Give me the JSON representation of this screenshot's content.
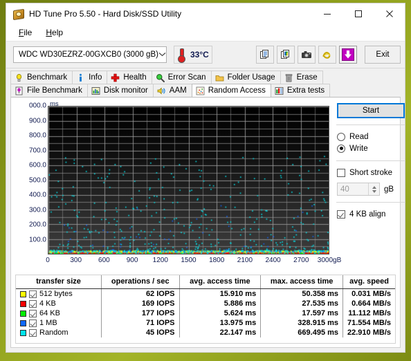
{
  "window": {
    "title": "HD Tune Pro 5.50 - Hard Disk/SSD Utility",
    "icon": "hard-disk-icon",
    "minimize": "—",
    "maximize": "☐",
    "close": "✕"
  },
  "menu": {
    "items": [
      {
        "label": "File",
        "accel": "F"
      },
      {
        "label": "Help",
        "accel": "H"
      }
    ]
  },
  "toolbar": {
    "drive": "WDC WD30EZRZ-00GXCB0 (3000 gB)",
    "drive_chevron": "⌄",
    "temperature": "33°C",
    "thermometer_icon": "thermometer-icon",
    "buttons": [
      {
        "name": "copy-text-button",
        "icon": "copy-text-icon"
      },
      {
        "name": "copy-image-button",
        "icon": "copy-image-icon"
      },
      {
        "name": "screenshot-button",
        "icon": "camera-icon"
      },
      {
        "name": "sound-button",
        "icon": "sound-wave-icon"
      },
      {
        "name": "save-button",
        "icon": "download-arrow-icon"
      }
    ],
    "exit_label": "Exit"
  },
  "tabs": {
    "row1": [
      {
        "label": "Benchmark",
        "icon": "lightbulb-icon",
        "active": false
      },
      {
        "label": "Info",
        "icon": "info-icon",
        "active": false
      },
      {
        "label": "Health",
        "icon": "red-cross-icon",
        "active": false
      },
      {
        "label": "Error Scan",
        "icon": "magnifier-icon",
        "active": false
      },
      {
        "label": "Folder Usage",
        "icon": "folder-icon",
        "active": false
      },
      {
        "label": "Erase",
        "icon": "trash-icon",
        "active": false
      }
    ],
    "row2": [
      {
        "label": "File Benchmark",
        "icon": "file-bulb-icon",
        "active": false
      },
      {
        "label": "Disk monitor",
        "icon": "bar-chart-icon",
        "active": false
      },
      {
        "label": "AAM",
        "icon": "speaker-icon",
        "active": false
      },
      {
        "label": "Random Access",
        "icon": "scatter-icon",
        "active": true
      },
      {
        "label": "Extra tests",
        "icon": "chart-grid-icon",
        "active": false
      }
    ]
  },
  "controls": {
    "start_label": "Start",
    "mode_options": [
      {
        "label": "Read",
        "selected": false
      },
      {
        "label": "Write",
        "selected": true
      }
    ],
    "short_stroke": {
      "label": "Short stroke",
      "checked": false
    },
    "short_stroke_value": "40",
    "short_stroke_unit": "gB",
    "align": {
      "label": "4 KB align",
      "checked": true
    }
  },
  "chart_data": {
    "type": "scatter",
    "title": "",
    "xlabel": "gB",
    "ylabel": "ms",
    "ylim": [
      0,
      1000
    ],
    "xlim": [
      0,
      3000
    ],
    "grid": true,
    "yticks": [
      "000.0",
      "900.0",
      "800.0",
      "700.0",
      "600.0",
      "500.0",
      "400.0",
      "300.0",
      "200.0",
      "100.0"
    ],
    "ytick_values": [
      1000,
      900,
      800,
      700,
      600,
      500,
      400,
      300,
      200,
      100
    ],
    "xticks": [
      "0",
      "300",
      "600",
      "900",
      "1200",
      "1500",
      "1800",
      "2100",
      "2400",
      "2700",
      "3000gB"
    ],
    "xtick_values": [
      0,
      300,
      600,
      900,
      1200,
      1500,
      1800,
      2100,
      2400,
      2700,
      3000
    ],
    "series": [
      {
        "name": "512 bytes",
        "color": "#ffff00"
      },
      {
        "name": "4 KB",
        "color": "#ff0000"
      },
      {
        "name": "64 KB",
        "color": "#00ee00"
      },
      {
        "name": "1 MB",
        "color": "#1068ff"
      },
      {
        "name": "Random",
        "color": "#00e5ee"
      }
    ],
    "notes": "Dense multicolour band of access-time samples along the bottom (0-40 ms) across the full 0-3000 gB span, with sparse cyan 'Random' outliers scattered up to ~660 ms."
  },
  "results": {
    "columns": [
      "transfer size",
      "operations / sec",
      "avg. access time",
      "max. access time",
      "avg. speed"
    ],
    "rows": [
      {
        "color": "#ffff00",
        "checked": true,
        "size": "512 bytes",
        "iops": "62 IOPS",
        "avg_access": "15.910 ms",
        "max_access": "50.358 ms",
        "avg_speed": "0.031 MB/s"
      },
      {
        "color": "#ff0000",
        "checked": true,
        "size": "4 KB",
        "iops": "169 IOPS",
        "avg_access": "5.886 ms",
        "max_access": "27.535 ms",
        "avg_speed": "0.664 MB/s"
      },
      {
        "color": "#00ee00",
        "checked": true,
        "size": "64 KB",
        "iops": "177 IOPS",
        "avg_access": "5.624 ms",
        "max_access": "17.597 ms",
        "avg_speed": "11.112 MB/s"
      },
      {
        "color": "#1068ff",
        "checked": true,
        "size": "1 MB",
        "iops": "71 IOPS",
        "avg_access": "13.975 ms",
        "max_access": "328.915 ms",
        "avg_speed": "71.554 MB/s"
      },
      {
        "color": "#00e5ee",
        "checked": true,
        "size": "Random",
        "iops": "45 IOPS",
        "avg_access": "22.147 ms",
        "max_access": "669.495 ms",
        "avg_speed": "22.910 MB/s"
      }
    ]
  },
  "colors": {
    "accent": "#0078d7",
    "desktop": "#8a9a1a",
    "plot_bg_top": "#000000",
    "plot_bg_bottom": "#3a3a3a",
    "grid": "#9a9a9a"
  }
}
